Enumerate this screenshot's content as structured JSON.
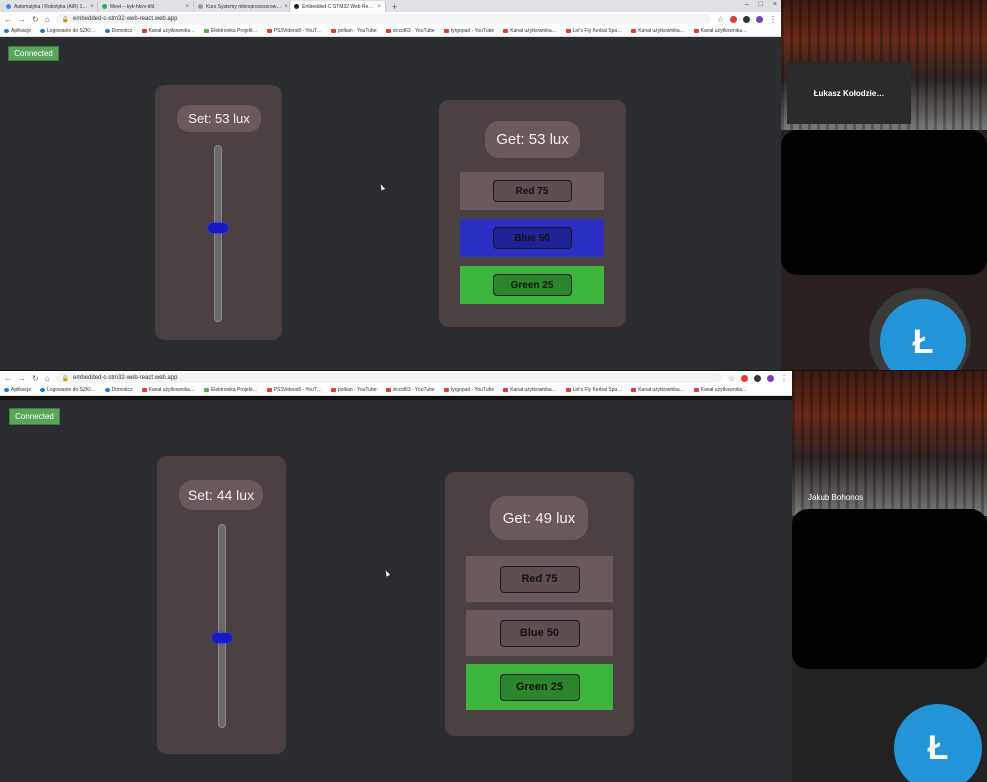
{
  "top": {
    "tabs": [
      {
        "label": "Automatyka i Robotyka (AiR) 1…"
      },
      {
        "label": "Meet – kyk-hkvv-kfd"
      },
      {
        "label": "Kurs Systemy mikroprocesorow…"
      },
      {
        "label": "Embedded-C STM32 Web Re…"
      }
    ],
    "url": "embedded-c-stm32-web-react.web.app",
    "bookmarks": [
      "Aplikacje",
      "Logowanie do SZKI…",
      "Domoticz",
      "Kanał użytkownika…",
      "Elektronika Projekt…",
      "PS3Videos8 - YouT…",
      "polkan - YouTube",
      "viccid63 - YouTube",
      "tyrgopad - YouTube",
      "Kanał użytkownika…",
      "Let's Fly Kerbal Spa…",
      "Kanał użytkownika…",
      "Kanał użytkownika…"
    ],
    "status": "Connected",
    "set_label": "Set: 53 lux",
    "set_value": 53,
    "get_label": "Get: 53 lux",
    "rows": [
      {
        "label": "Red 75",
        "state": "off"
      },
      {
        "label": "Blue 50",
        "state": "on"
      },
      {
        "label": "Green 25",
        "state": "on"
      }
    ],
    "participant_name": "Łukasz Kołodzie…",
    "avatar_letter": "Ł"
  },
  "bottom": {
    "url": "embedded-c-stm32-web-react.web.app",
    "bookmarks": [
      "Aplikacje",
      "Logowanie do SZKI…",
      "Domoticz",
      "Kanał użytkownika…",
      "Elektronika Projekt…",
      "PS3Videos8 - YouT…",
      "polkan - YouTube",
      "viccid63 - YouTube",
      "tyrgopad - YouTube",
      "Kanał użytkownika…",
      "Let's Fly Kerbal Spa…",
      "Kanał użytkownika…",
      "Kanał użytkownika…"
    ],
    "status": "Connected",
    "set_label": "Set: 44 lux",
    "set_value": 44,
    "get_label": "Get: 49 lux",
    "rows": [
      {
        "label": "Red 75",
        "state": "off"
      },
      {
        "label": "Blue 50",
        "state": "off"
      },
      {
        "label": "Green 25",
        "state": "on"
      }
    ],
    "participant_name": "Jakub Bohonos",
    "avatar_letter": "Ł"
  },
  "colors": {
    "background": "#2b2d31",
    "card": "#4b4142",
    "row_off": "#6a5a5b",
    "blue_on": "#2b2fc4",
    "green_on": "#3bb53b",
    "connected": "#5aa55a",
    "thumb": "#1618c9",
    "avatar": "#2494d8"
  },
  "icons": [
    "back-arrow-icon",
    "forward-arrow-icon",
    "reload-icon",
    "home-icon",
    "lock-icon",
    "star-icon",
    "extension-icon",
    "profile-icon",
    "menu-dots-icon",
    "cursor-icon"
  ]
}
